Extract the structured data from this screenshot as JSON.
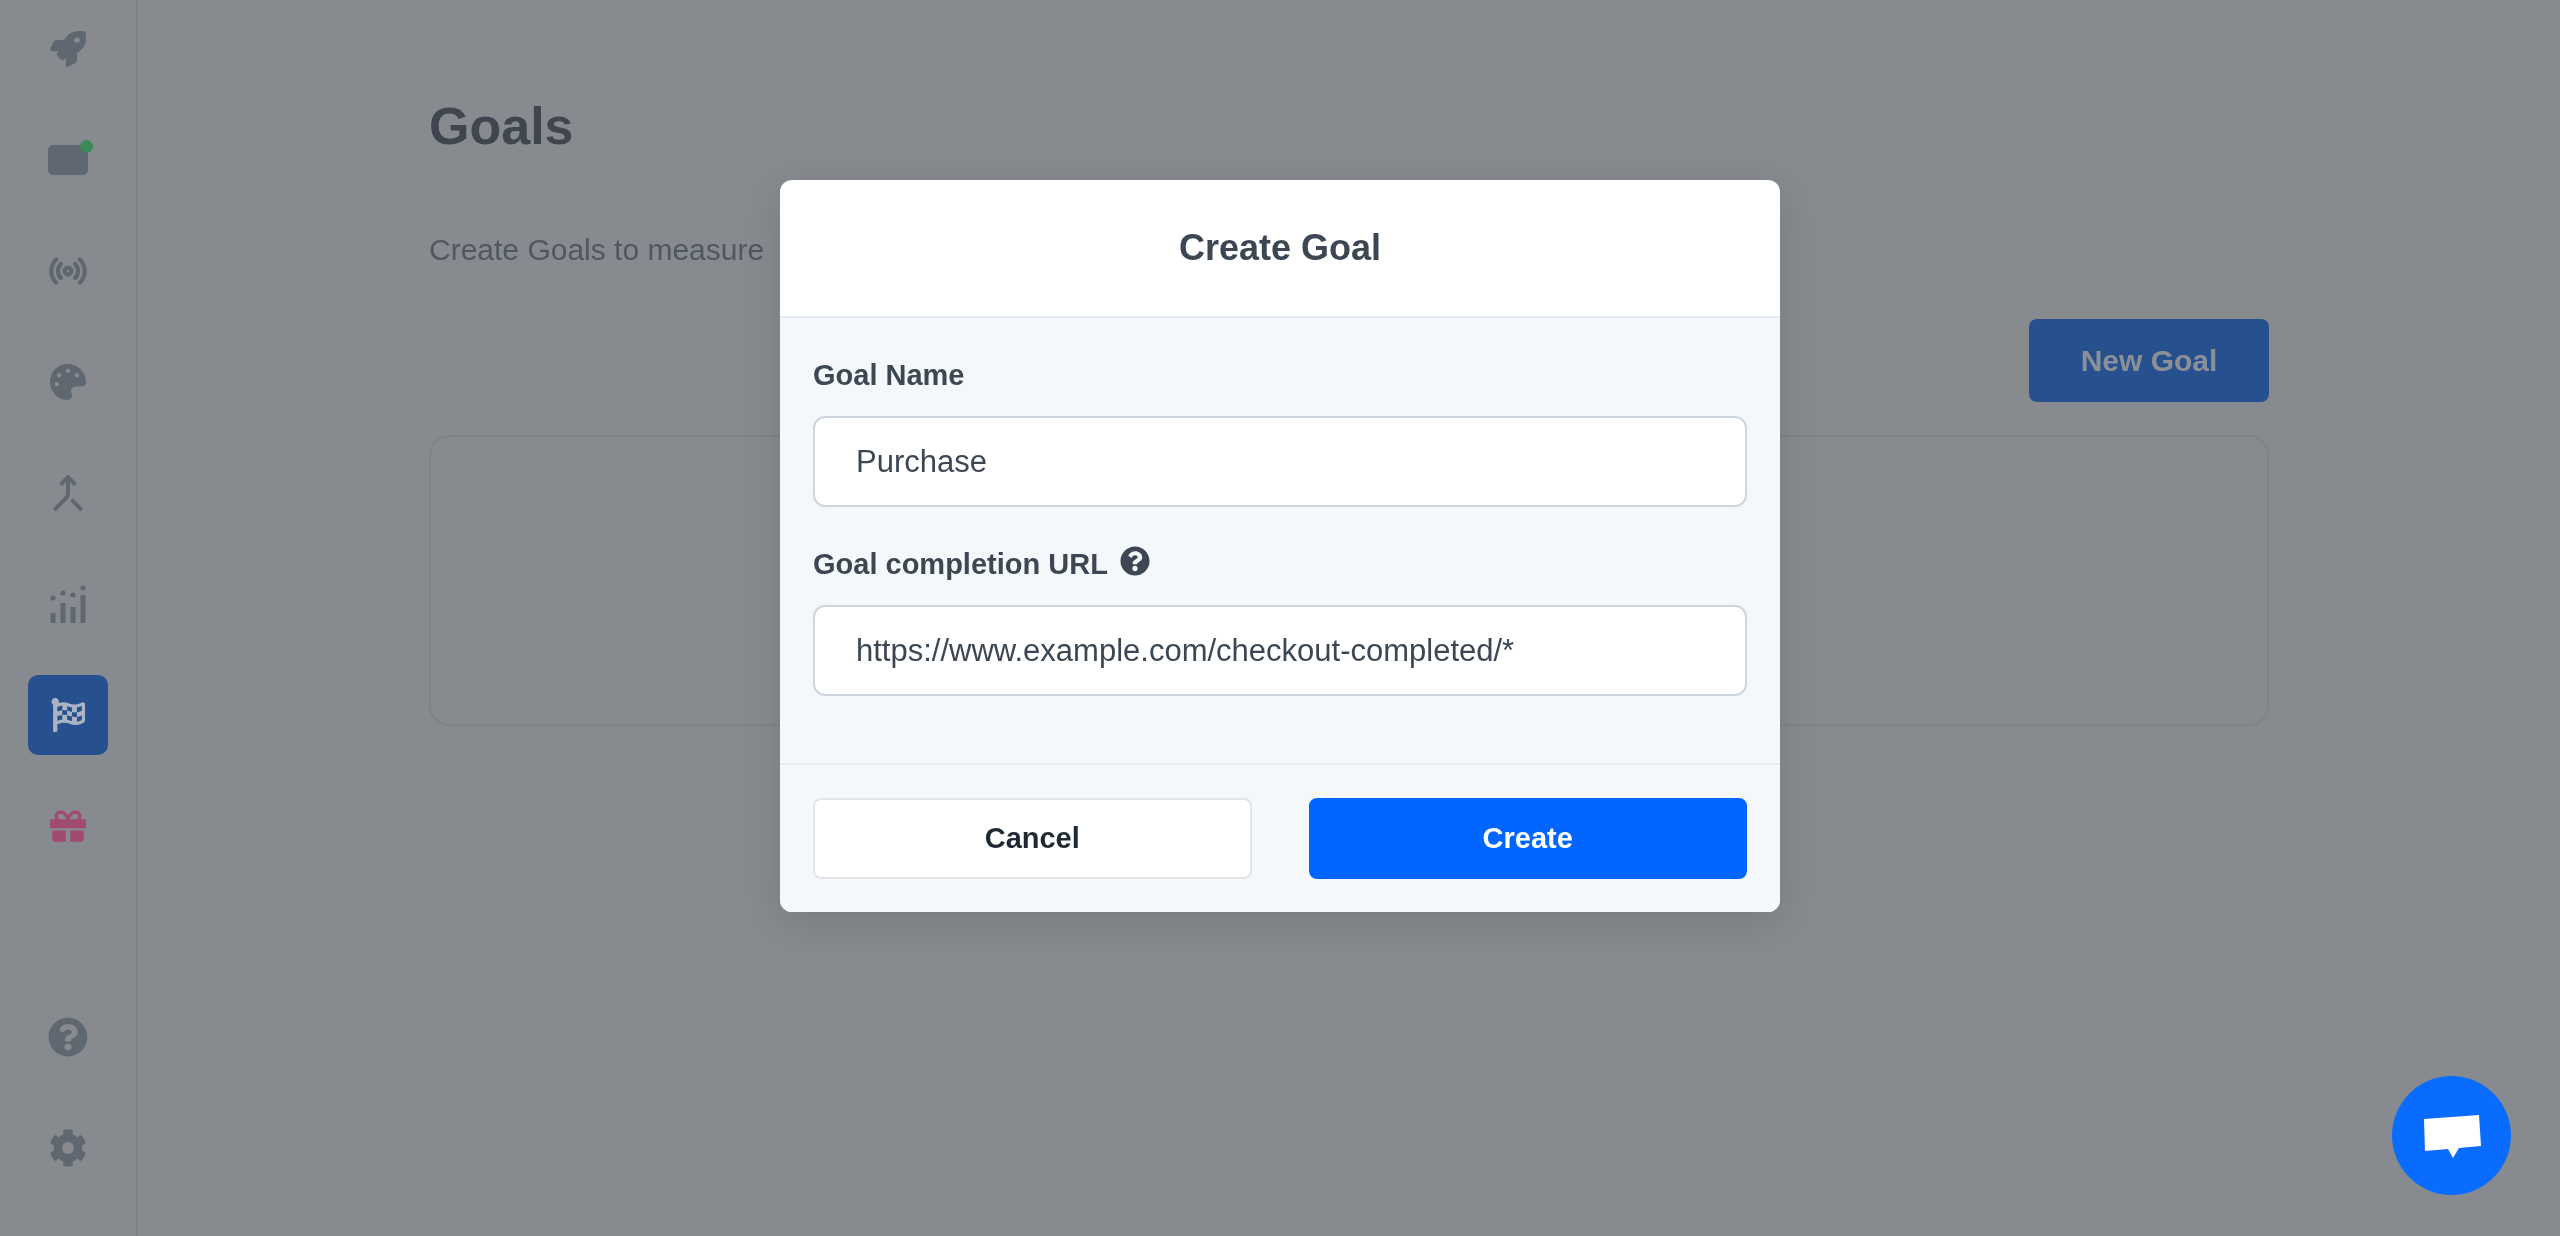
{
  "sidebar": {
    "items": [
      {
        "selected": false,
        "notification": false
      },
      {
        "selected": false,
        "notification": true
      },
      {
        "selected": false,
        "notification": false
      },
      {
        "selected": false,
        "notification": false
      },
      {
        "selected": false,
        "notification": false
      },
      {
        "selected": false,
        "notification": false
      },
      {
        "selected": true,
        "notification": false
      },
      {
        "selected": false,
        "notification": false
      }
    ],
    "bottom_items": [
      {
        "selected": false
      },
      {
        "selected": false
      }
    ]
  },
  "page": {
    "title": "Goals",
    "description": "Create Goals to measure",
    "new_goal_button": "New Goal"
  },
  "modal": {
    "title": "Create Goal",
    "fields": [
      {
        "label": "Goal Name",
        "value": "Purchase",
        "help": false
      },
      {
        "label": "Goal completion URL",
        "value": "https://www.example.com/checkout-completed/*",
        "help": true
      }
    ],
    "buttons": [
      {
        "label": "Cancel",
        "kind": "secondary"
      },
      {
        "label": "Create",
        "kind": "primary"
      }
    ]
  }
}
